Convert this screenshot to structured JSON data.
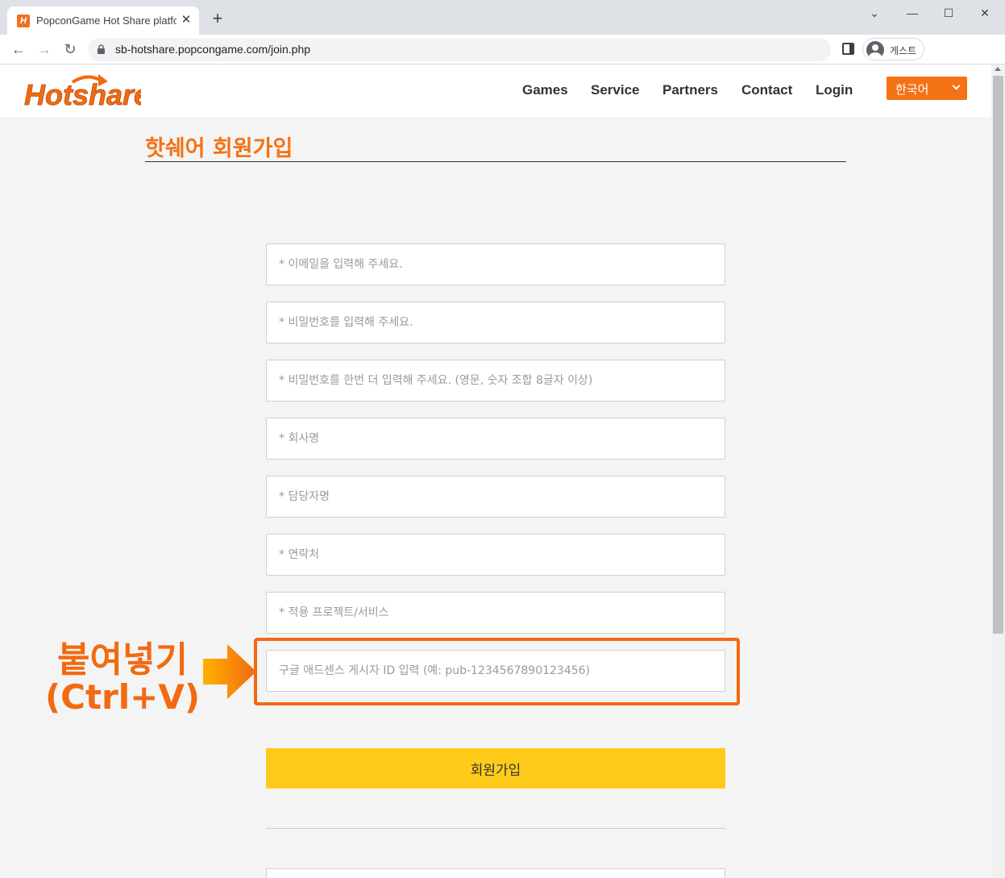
{
  "browser": {
    "tab_title": "PopconGame Hot Share platform",
    "tab_favicon_letter": "H",
    "url": "sb-hotshare.popcongame.com/join.php",
    "profile_name": "게스트",
    "close_glyph": "✕",
    "new_tab_glyph": "+",
    "back_glyph": "←",
    "forward_glyph": "→",
    "reload_glyph": "↻",
    "minimize_glyph": "⌄",
    "restore_glyph": "—",
    "maximize_glyph": "☐"
  },
  "site": {
    "logo_text": "Hotshare",
    "nav": [
      "Games",
      "Service",
      "Partners",
      "Contact",
      "Login"
    ],
    "language": "한국어",
    "brand_color": "#f47216"
  },
  "form": {
    "title": "핫쉐어 회원가입",
    "fields": [
      {
        "placeholder": "* 이메일을 입력해 주세요.",
        "value": ""
      },
      {
        "placeholder": "* 비밀번호를 입력해 주세요.",
        "value": ""
      },
      {
        "placeholder": "* 비밀번호를 한번 더 입력해 주세요. (영문, 숫자 조합 8글자 이상)",
        "value": ""
      },
      {
        "placeholder": "* 회사명",
        "value": ""
      },
      {
        "placeholder": "* 담당자명",
        "value": ""
      },
      {
        "placeholder": "* 연락처",
        "value": ""
      },
      {
        "placeholder": "* 적용 프로젝트/서비스",
        "value": ""
      },
      {
        "placeholder": "구글 애드센스 게시자 ID 입력 (예: pub-1234567890123456)",
        "value": ""
      }
    ],
    "submit_label": "회원가입",
    "submit_color": "#fecb1a"
  },
  "annotation": {
    "line1": "붙여넣기",
    "line2": "(Ctrl+V)",
    "color": "#f26a11"
  }
}
